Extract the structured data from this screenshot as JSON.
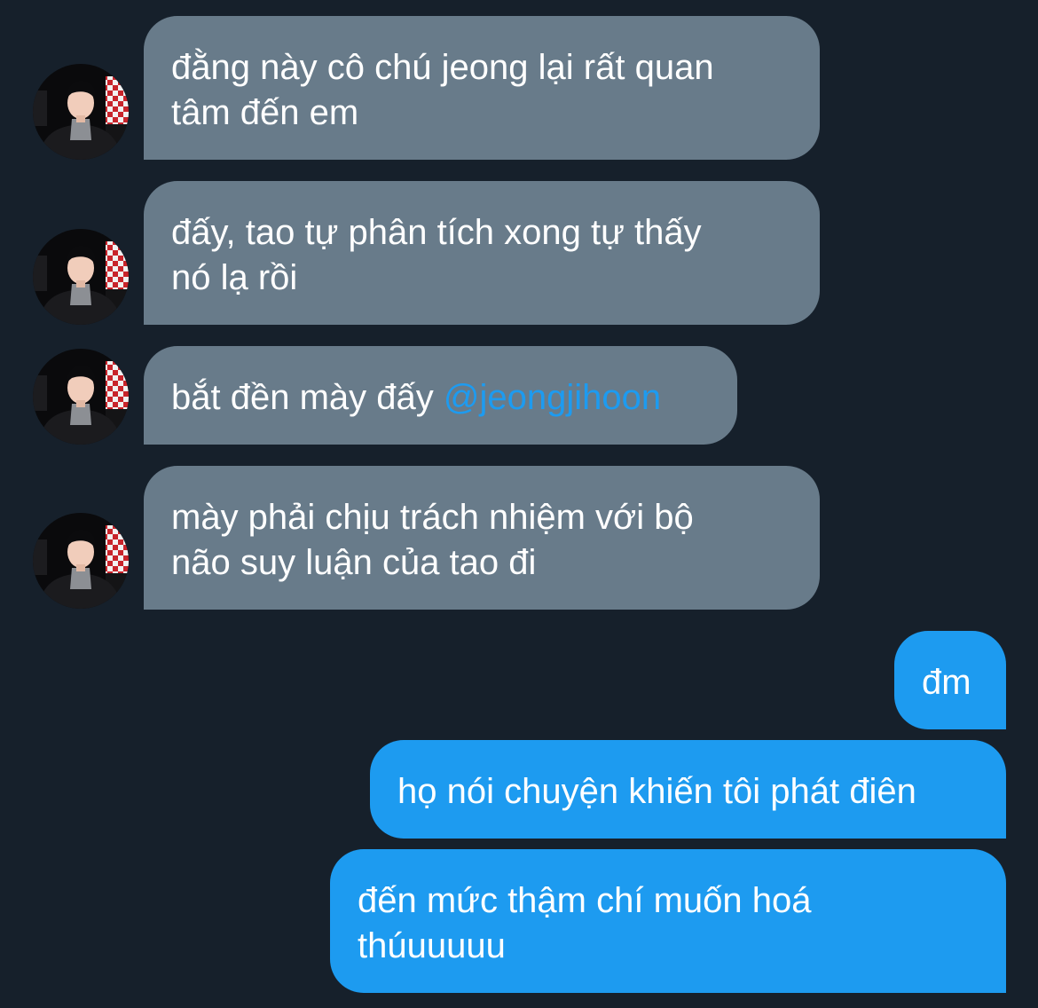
{
  "incoming_messages": [
    {
      "lines": [
        "đằng này cô chú jeong lại rất quan",
        "tâm đến em"
      ]
    },
    {
      "lines": [
        "đấy, tao tự phân tích xong tự thấy",
        "nó lạ rồi"
      ]
    },
    {
      "text": "bắt đền mày đấy ",
      "mention": "@jeongjihoon"
    },
    {
      "lines": [
        "mày phải chịu trách nhiệm với bộ",
        "não suy luận của tao đi"
      ]
    }
  ],
  "outgoing_messages": [
    {
      "lines": [
        "đm"
      ]
    },
    {
      "lines": [
        "họ nói chuyện khiến tôi phát điên"
      ]
    },
    {
      "lines": [
        "đến mức thậm chí muốn hoá",
        "thúuuuuu"
      ]
    }
  ],
  "colors": {
    "background": "#16202b",
    "incoming_bubble": "#687b8a",
    "outgoing_bubble": "#1d9bf0",
    "mention": "#1d9bf0"
  },
  "icons": {
    "avatar": "user-profile-photo"
  }
}
